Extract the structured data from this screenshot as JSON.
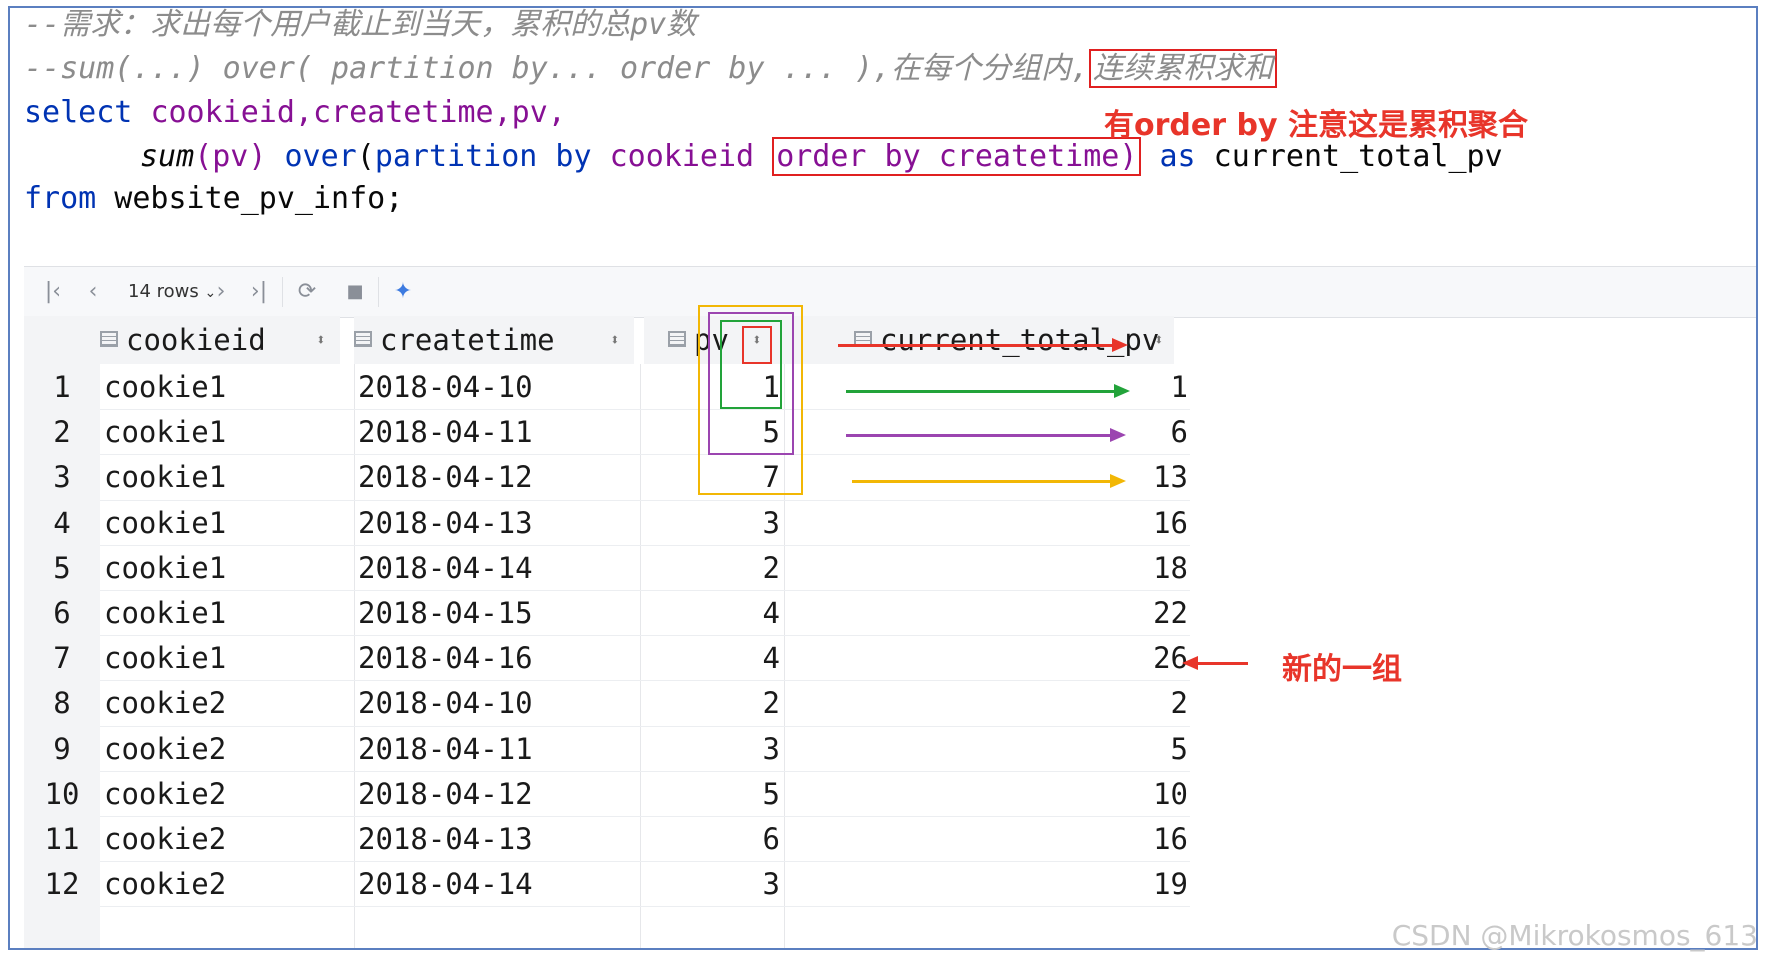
{
  "editor": {
    "comment1": "--需求：求出每个用户截止到当天，累积的总pv数",
    "comment2_a": "--sum(...) over( partition by... order by ... ),在每个分组内,",
    "comment2_b": "连续累积求和",
    "l3_kw": "select ",
    "l3_fields": "cookieid,createtime,pv,",
    "l4_fn": "sum",
    "l4_a": "(pv) ",
    "l4_over": "over",
    "l4_b": "(",
    "l4_partition": "partition by ",
    "l4_field": "cookieid ",
    "l4_box": "order by createtime)",
    "l4_as": "as",
    "l4_alias": " current_total_pv",
    "l5_kw": "from",
    "l5_rest": " website_pv_info;"
  },
  "annotations": {
    "order_by_note": "有order by 注意这是累积聚合",
    "new_group_note": "新的一组"
  },
  "toolbar": {
    "first_icon": "first-page-icon",
    "prev_icon": "prev-page-icon",
    "rows_label": "14 rows",
    "next_icon": "next-page-icon",
    "last_icon": "last-page-icon",
    "refresh_icon": "refresh-icon",
    "stop_icon": "stop-icon",
    "pin_icon": "pin-icon"
  },
  "grid": {
    "columns": [
      "cookieid",
      "createtime",
      "pv",
      "current_total_pv"
    ],
    "rows": [
      {
        "n": "1",
        "cookieid": "cookie1",
        "createtime": "2018-04-10",
        "pv": "1",
        "total": "1"
      },
      {
        "n": "2",
        "cookieid": "cookie1",
        "createtime": "2018-04-11",
        "pv": "5",
        "total": "6"
      },
      {
        "n": "3",
        "cookieid": "cookie1",
        "createtime": "2018-04-12",
        "pv": "7",
        "total": "13"
      },
      {
        "n": "4",
        "cookieid": "cookie1",
        "createtime": "2018-04-13",
        "pv": "3",
        "total": "16"
      },
      {
        "n": "5",
        "cookieid": "cookie1",
        "createtime": "2018-04-14",
        "pv": "2",
        "total": "18"
      },
      {
        "n": "6",
        "cookieid": "cookie1",
        "createtime": "2018-04-15",
        "pv": "4",
        "total": "22"
      },
      {
        "n": "7",
        "cookieid": "cookie1",
        "createtime": "2018-04-16",
        "pv": "4",
        "total": "26"
      },
      {
        "n": "8",
        "cookieid": "cookie2",
        "createtime": "2018-04-10",
        "pv": "2",
        "total": "2"
      },
      {
        "n": "9",
        "cookieid": "cookie2",
        "createtime": "2018-04-11",
        "pv": "3",
        "total": "5"
      },
      {
        "n": "10",
        "cookieid": "cookie2",
        "createtime": "2018-04-12",
        "pv": "5",
        "total": "10"
      },
      {
        "n": "11",
        "cookieid": "cookie2",
        "createtime": "2018-04-13",
        "pv": "6",
        "total": "16"
      },
      {
        "n": "12",
        "cookieid": "cookie2",
        "createtime": "2018-04-14",
        "pv": "3",
        "total": "19"
      }
    ]
  },
  "colors": {
    "red": "#e8352a",
    "green": "#22a33a",
    "purple": "#9b45b0",
    "yellow": "#f2b705"
  },
  "watermark": "CSDN @Mikrokosmos_613"
}
